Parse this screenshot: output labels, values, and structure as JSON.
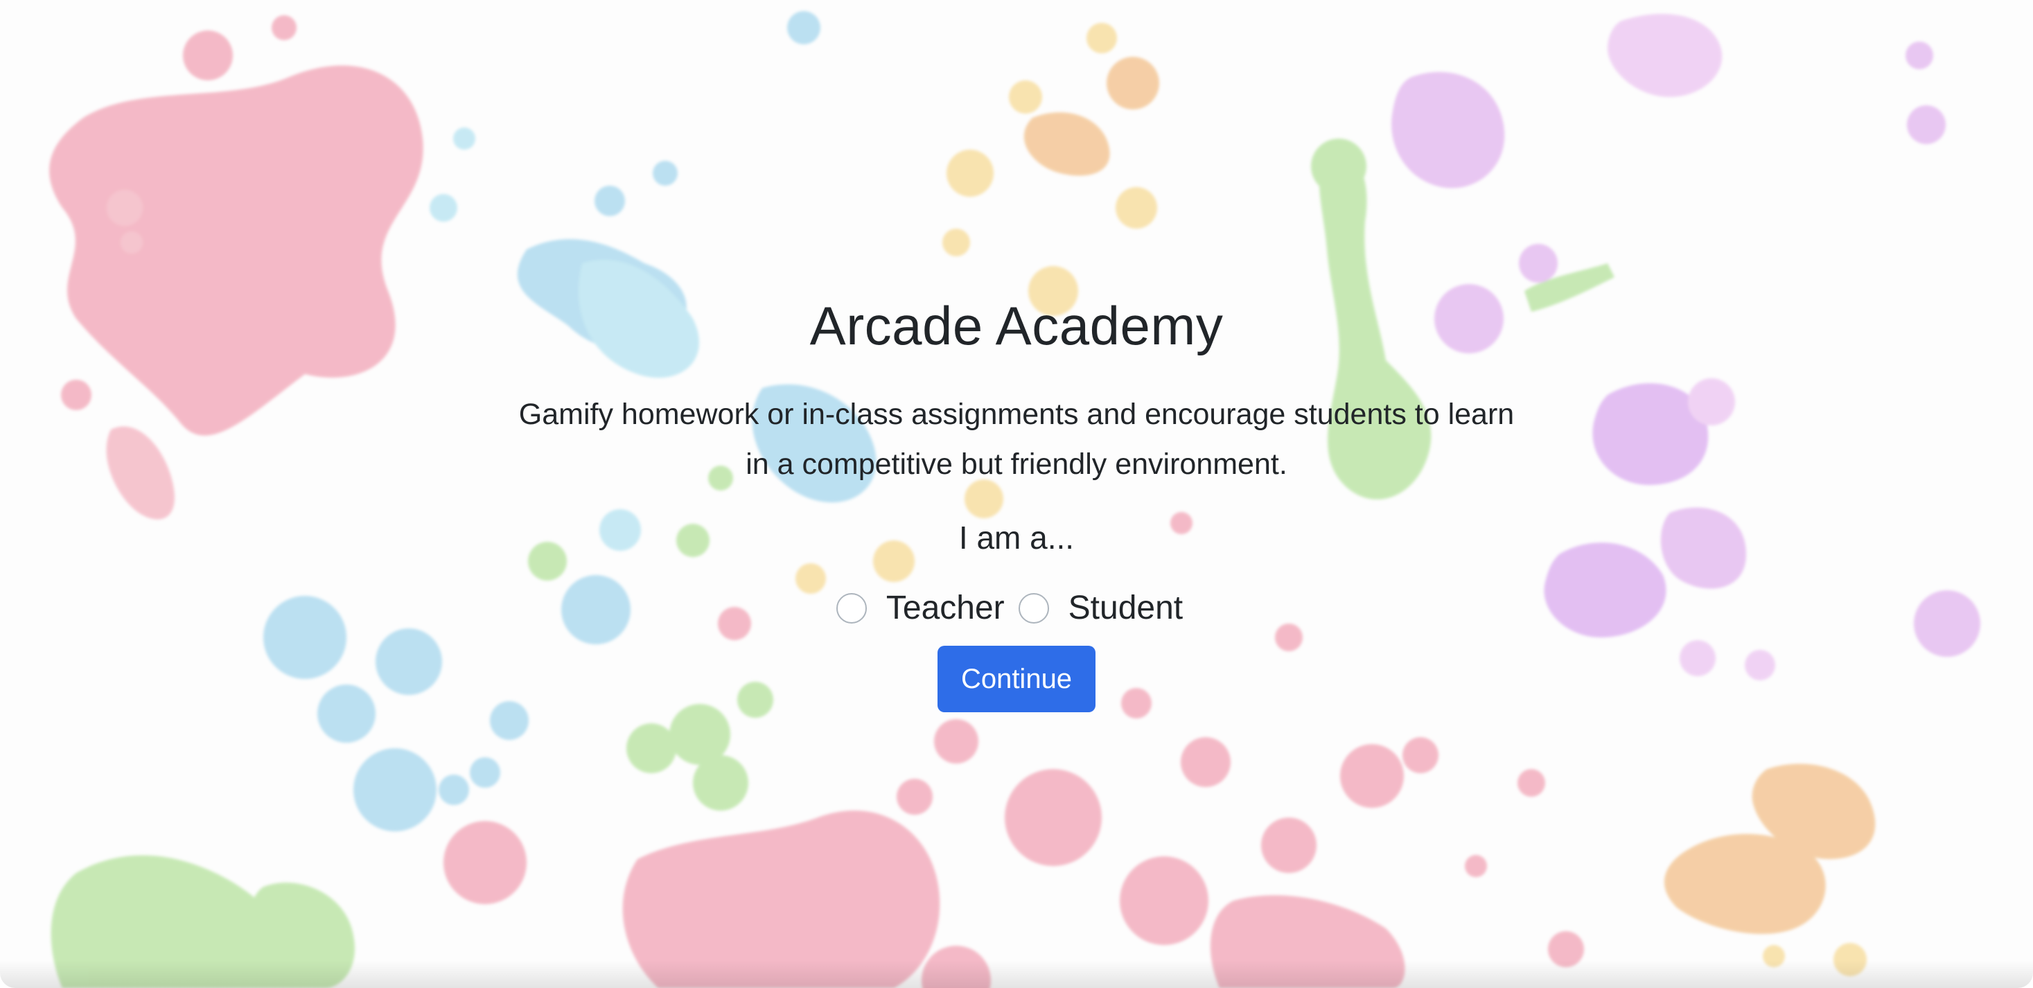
{
  "page": {
    "title": "Arcade Academy",
    "description": "Gamify homework or in-class assignments and encourage students to learn in a competitive but friendly environment.",
    "prompt": "I am a...",
    "roles": [
      {
        "label": "Teacher",
        "selected": false
      },
      {
        "label": "Student",
        "selected": false
      }
    ],
    "continue_label": "Continue"
  },
  "colors": {
    "primary_button": "#2e6de8",
    "text": "#212529",
    "radio_border": "#adb5bd",
    "splash_pink": "#f2a7b8",
    "splash_blue": "#a9d8ee",
    "splash_yellow": "#f7dc9a",
    "splash_green": "#b8e3a0",
    "splash_purple": "#e3b8ef",
    "splash_orange": "#f3c28e"
  }
}
